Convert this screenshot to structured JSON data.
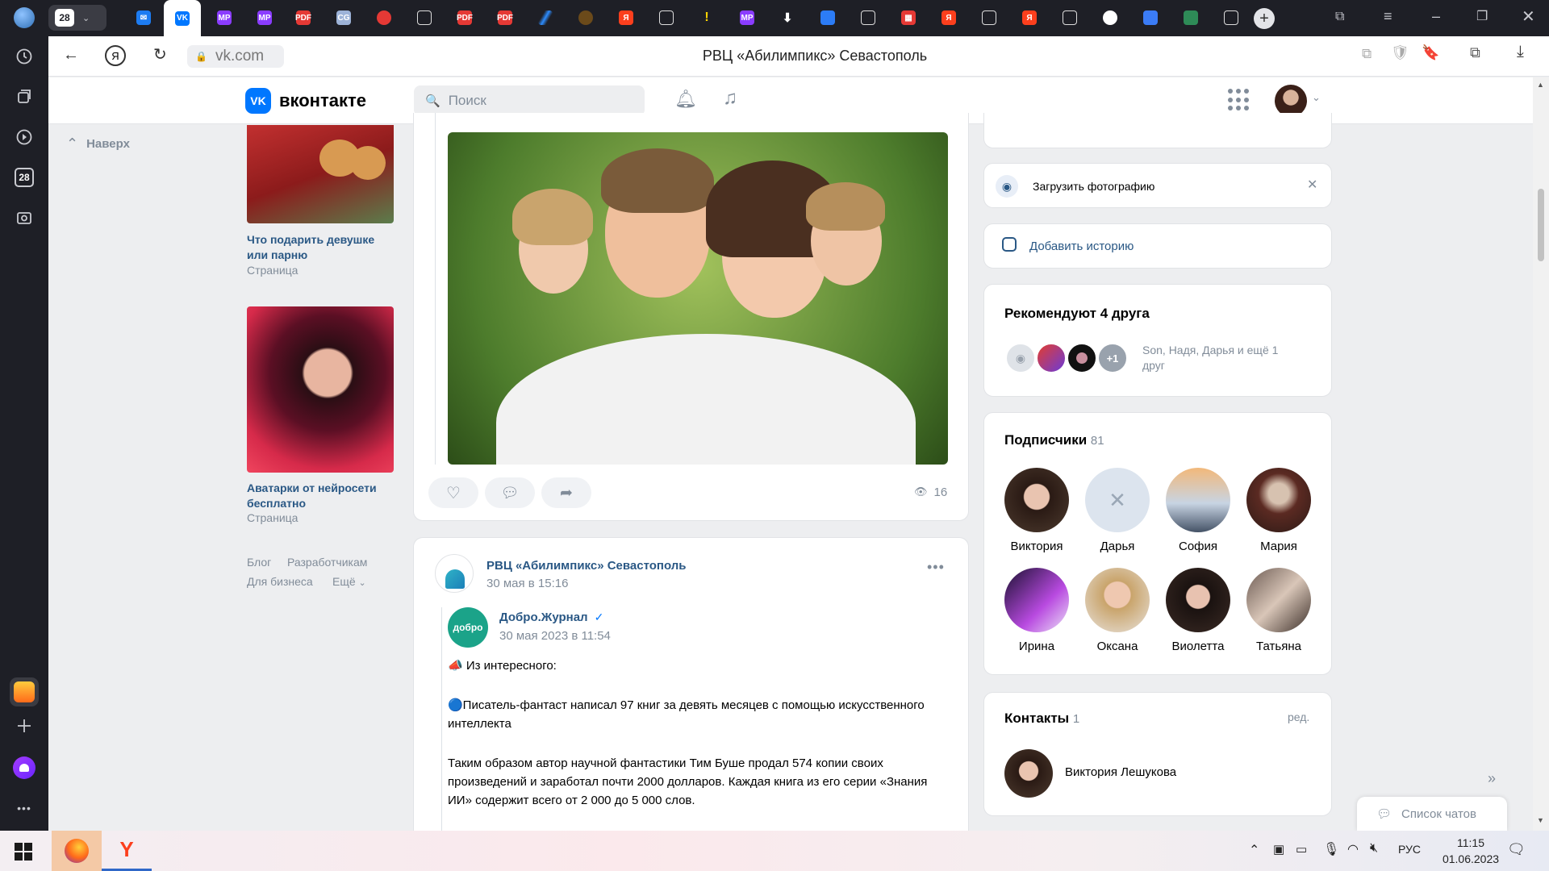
{
  "browser": {
    "tab_count": "28",
    "address": "vk.com",
    "page_title": "РВЦ «Абилимпикс» Севастополь",
    "rail_badge": "28"
  },
  "vk": {
    "logo_text": "вконтакте",
    "search_placeholder": "Поиск",
    "back_to_top": "Наверх"
  },
  "left_col": {
    "ads": [
      {
        "title": "Что подарить девушке или парню",
        "type": "Страница"
      },
      {
        "title": "Аватарки от нейросети бесплатно",
        "type": "Страница"
      }
    ],
    "footer": {
      "blog": "Блог",
      "devs": "Разработчикам",
      "business": "Для бизнеса",
      "more": "Ещё"
    }
  },
  "post1": {
    "views": "16"
  },
  "post2": {
    "author": "РВЦ «Абилимпикс» Севастополь",
    "date": "30 мая в 15:16",
    "repost_author": "Добро.Журнал",
    "repost_date": "30 мая 2023 в 11:54",
    "line1": "📣 Из интересного:",
    "line2": "🔵Писатель-фантаст написал 97 книг за девять месяцев с помощью искусственного интеллекта",
    "line3": "Таким образом автор научной фантастики Тим Буше продал 574 копии своих произведений и заработал почти 2000 долларов. Каждая книга из его серии «Знания ИИ» содержит всего от 2 000 до 5 000 слов.",
    "logo_text": "добро"
  },
  "right_col": {
    "upload_photo": "Загрузить фотографию",
    "add_story": "Добавить историю",
    "recommend_title": "Рекомендуют 4 друга",
    "recommend_plus": "+1",
    "recommend_names": "Son, Надя, Дарья и ещё 1 друг",
    "subs_title": "Подписчики",
    "subs_count": "81",
    "subscribers": [
      "Виктория",
      "Дарья",
      "София",
      "Мария",
      "Ирина",
      "Оксана",
      "Виолетта",
      "Татьяна"
    ],
    "contacts_title": "Контакты",
    "contacts_count": "1",
    "contacts_edit": "ред.",
    "contact_name": "Виктория Лешукова",
    "chat_list": "Список чатов"
  },
  "taskbar": {
    "lang": "РУС",
    "time": "11:15",
    "date": "01.06.2023"
  },
  "colors": {
    "vk_blue": "#0077ff",
    "link": "#2a5885",
    "muted": "#818c99"
  }
}
